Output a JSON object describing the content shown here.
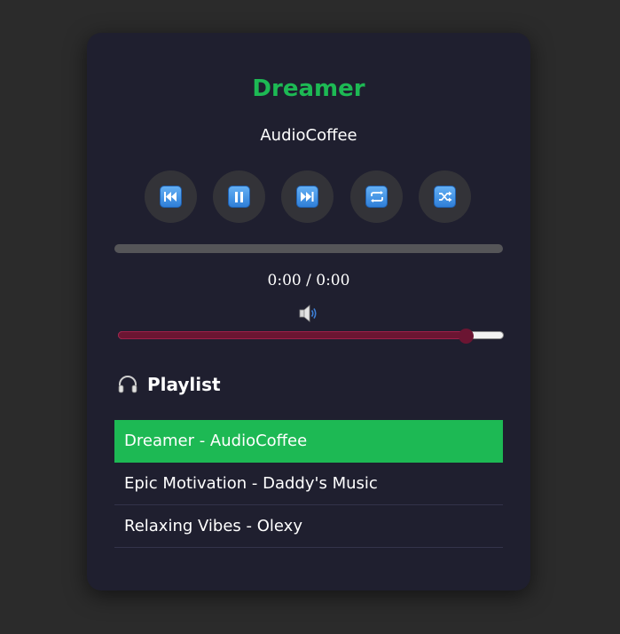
{
  "track": {
    "title": "Dreamer",
    "artist": "AudioCoffee",
    "time_display": "0:00 / 0:00",
    "progress": 0
  },
  "controls": [
    {
      "name": "previous-button",
      "icon": "previous-track-icon"
    },
    {
      "name": "pause-button",
      "icon": "pause-icon"
    },
    {
      "name": "next-button",
      "icon": "next-track-icon"
    },
    {
      "name": "repeat-button",
      "icon": "repeat-icon"
    },
    {
      "name": "shuffle-button",
      "icon": "shuffle-icon"
    }
  ],
  "volume": {
    "icon": "speaker-icon",
    "level": 0.9
  },
  "playlist": {
    "heading": "Playlist",
    "icon": "headphones-icon",
    "items": [
      {
        "label": "Dreamer - AudioCoffee",
        "active": true
      },
      {
        "label": "Epic Motivation - Daddy's Music",
        "active": false
      },
      {
        "label": "Relaxing Vibes - Olexy",
        "active": false
      }
    ]
  },
  "colors": {
    "accent": "#1db954",
    "panel": "#1f1f2f",
    "background": "#2b2b2b",
    "volume_fill": "#6b1532"
  }
}
